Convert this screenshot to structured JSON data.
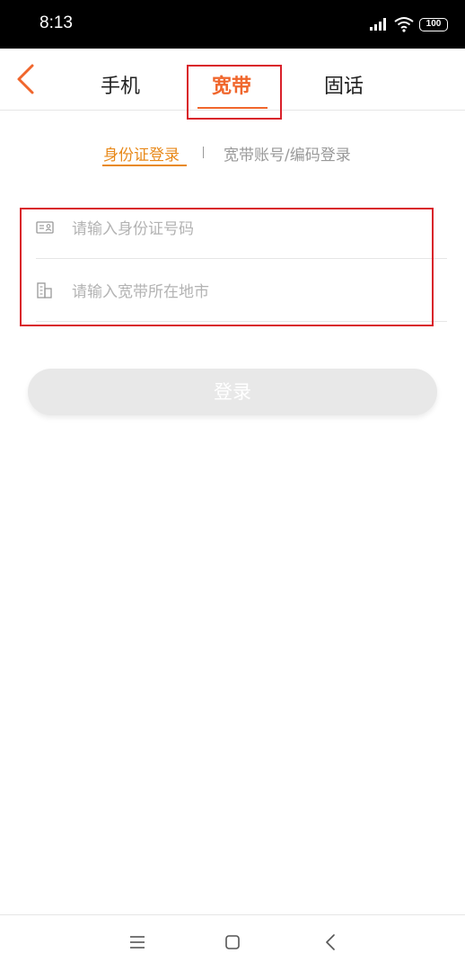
{
  "status_bar": {
    "time": "8:13",
    "battery": "100"
  },
  "nav": {
    "tabs": [
      {
        "label": "手机"
      },
      {
        "label": "宽带"
      },
      {
        "label": "固话"
      }
    ],
    "active_tab": "宽带"
  },
  "login_type": {
    "id_login": "身份证登录",
    "separator": "|",
    "account_login": "宽带账号/编码登录"
  },
  "form": {
    "id_placeholder": "请输入身份证号码",
    "city_placeholder": "请输入宽带所在地市"
  },
  "login_button": {
    "label": "登录"
  },
  "colors": {
    "accent": "#f0662c",
    "highlight": "#d9202a",
    "secondary": "#e8891a"
  }
}
